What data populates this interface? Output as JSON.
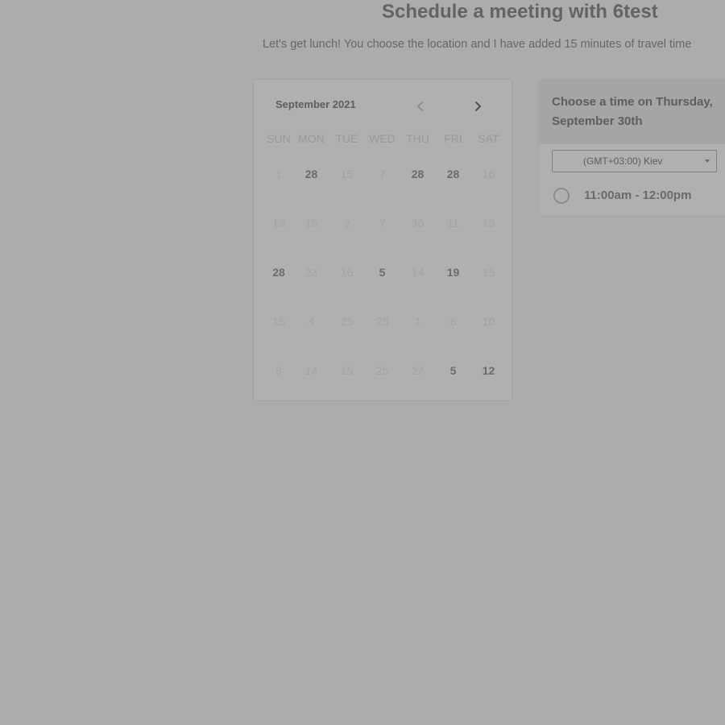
{
  "header": {
    "title": "Schedule a meeting with 6test",
    "subtitle": "Let's get lunch! You choose the location and I have added 15 minutes of travel time"
  },
  "calendar": {
    "month_label": "September 2021",
    "prev_icon": "chevron-left-icon",
    "next_icon": "chevron-right-icon",
    "weekdays": [
      "SUN",
      "MON",
      "TUE",
      "WED",
      "THU",
      "FRI",
      "SAT"
    ],
    "weeks": [
      [
        {
          "label": "1",
          "available": false
        },
        {
          "label": "28",
          "available": true
        },
        {
          "label": "15",
          "available": false
        },
        {
          "label": "7",
          "available": false
        },
        {
          "label": "28",
          "available": true
        },
        {
          "label": "28",
          "available": true
        },
        {
          "label": "16",
          "available": false
        }
      ],
      [
        {
          "label": "13",
          "available": false
        },
        {
          "label": "15",
          "available": false
        },
        {
          "label": "2",
          "available": false
        },
        {
          "label": "7",
          "available": false
        },
        {
          "label": "30",
          "available": false
        },
        {
          "label": "11",
          "available": false
        },
        {
          "label": "15",
          "available": false
        }
      ],
      [
        {
          "label": "28",
          "available": true
        },
        {
          "label": "23",
          "available": false
        },
        {
          "label": "16",
          "available": false
        },
        {
          "label": "5",
          "available": true
        },
        {
          "label": "14",
          "available": false
        },
        {
          "label": "19",
          "available": true
        },
        {
          "label": "15",
          "available": false
        }
      ],
      [
        {
          "label": "15",
          "available": false
        },
        {
          "label": "4",
          "available": false
        },
        {
          "label": "25",
          "available": false
        },
        {
          "label": "25",
          "available": false
        },
        {
          "label": "1",
          "available": false
        },
        {
          "label": "6",
          "available": false
        },
        {
          "label": "10",
          "available": false
        }
      ],
      [
        {
          "label": "8",
          "available": false
        },
        {
          "label": "14",
          "available": false
        },
        {
          "label": "15",
          "available": false
        },
        {
          "label": "25",
          "available": false
        },
        {
          "label": "27",
          "available": false
        },
        {
          "label": "5",
          "available": true
        },
        {
          "label": "12",
          "available": true
        }
      ]
    ]
  },
  "time_panel": {
    "heading": "Choose a time on Thursday, September 30th",
    "timezone": "(GMT+03:00) Kiev",
    "slots": [
      {
        "label": "11:00am - 12:00pm",
        "selected": false
      }
    ]
  }
}
